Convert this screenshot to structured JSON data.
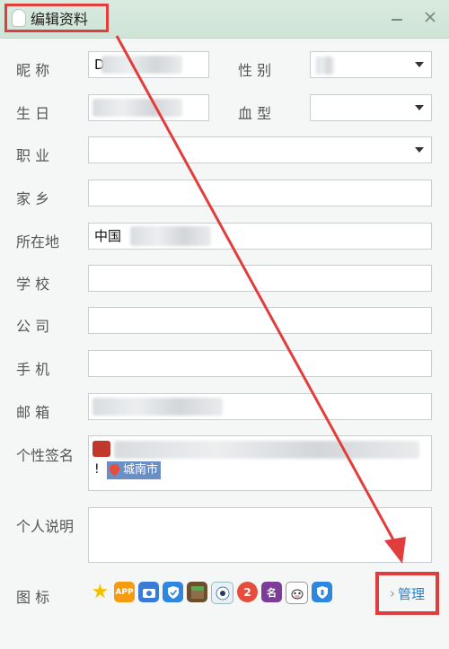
{
  "window": {
    "title": "编辑资料",
    "minimize_icon": "minimize-icon",
    "close_icon": "close-icon"
  },
  "form": {
    "nickname": {
      "label": "昵  称",
      "value": "D"
    },
    "gender": {
      "label": "性  别",
      "value": ""
    },
    "birthday": {
      "label": "生  日",
      "value": ""
    },
    "blood_type": {
      "label": "血  型",
      "value": ""
    },
    "occupation": {
      "label": "职  业",
      "value": ""
    },
    "hometown": {
      "label": "家  乡",
      "value": ""
    },
    "location": {
      "label": "所在地",
      "value": "中国"
    },
    "school": {
      "label": "学  校",
      "value": ""
    },
    "company": {
      "label": "公  司",
      "value": ""
    },
    "phone": {
      "label": "手  机",
      "value": ""
    },
    "email": {
      "label": "邮  箱",
      "value": ""
    },
    "signature": {
      "label": "个性签名",
      "line2_prefix": "!",
      "location_tag": "城南市"
    },
    "description": {
      "label": "个人说明",
      "value": ""
    }
  },
  "icons": {
    "label": "图  标",
    "items": [
      "star-icon",
      "app-icon",
      "camera-icon",
      "shield-check-icon",
      "game-block-icon",
      "penguin-eye-icon",
      "badge-2-icon",
      "character-icon",
      "cow-icon",
      "shield-icon"
    ],
    "manage_label": "管理",
    "manage_chevron": "›"
  },
  "colors": {
    "titlebar": "#d3e6da",
    "highlight_red": "#e23d3d",
    "link_blue": "#2a7fc8"
  }
}
